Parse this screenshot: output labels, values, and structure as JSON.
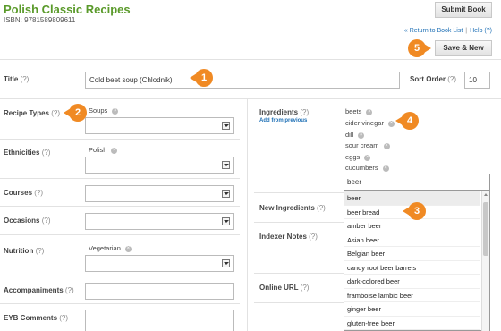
{
  "header": {
    "book_title": "Polish Classic Recipes",
    "isbn": "ISBN: 9781589809611",
    "submit_label": "Submit Book",
    "return_link": "« Return to Book List",
    "help_link": "Help (?)",
    "save_label": "Save & New"
  },
  "form": {
    "title_label": "Title",
    "title_value": "Cold beet soup (Chlodnik)",
    "sort_order_label": "Sort Order",
    "sort_order_value": "10",
    "recipe_types_label": "Recipe Types",
    "recipe_types_tag": "Soups",
    "ethnicities_label": "Ethnicities",
    "ethnicities_tag": "Polish",
    "courses_label": "Courses",
    "occasions_label": "Occasions",
    "nutrition_label": "Nutrition",
    "nutrition_tag": "Vegetarian",
    "accompaniments_label": "Accompaniments",
    "eyb_comments_label": "EYB Comments",
    "ingredients_label": "Ingredients",
    "add_from_previous": "Add from previous",
    "ingredients": [
      "beets",
      "cider vinegar",
      "dill",
      "sour cream",
      "eggs",
      "cucumbers"
    ],
    "ingredient_input_value": "beer",
    "new_ingredients_label": "New Ingredients",
    "indexer_notes_label": "Indexer Notes",
    "online_url_label": "Online URL",
    "help_mark": "(?)",
    "remove_mark": "×"
  },
  "autocomplete": {
    "items": [
      "beer",
      "beer bread",
      "amber beer",
      "Asian beer",
      "Belgian beer",
      "candy root beer barrels",
      "dark-colored beer",
      "framboise lambic beer",
      "ginger beer",
      "gluten-free beer"
    ],
    "highlighted": 0
  },
  "callouts": [
    "1",
    "2",
    "3",
    "4",
    "5"
  ],
  "colors": {
    "title_green": "#5a9a2a",
    "callout_orange": "#f08a24",
    "link_blue": "#1d6fb5"
  }
}
